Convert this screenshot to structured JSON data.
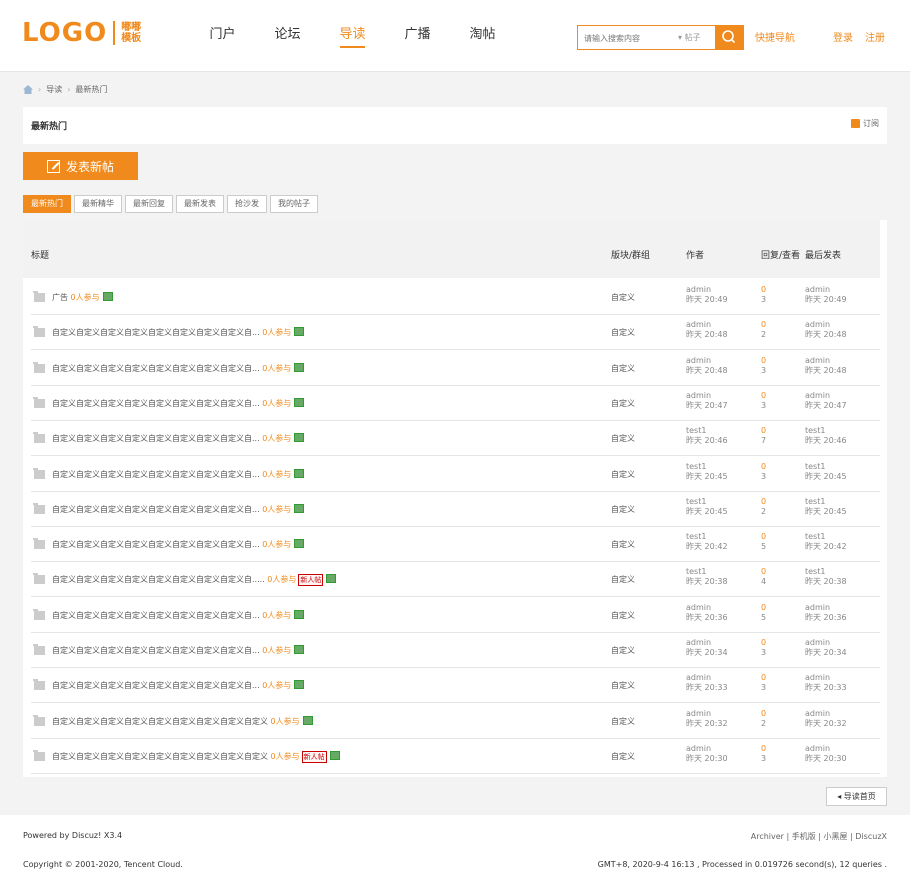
{
  "logo": {
    "text": "LOGO",
    "sub1": "嘟嘟",
    "sub2": "模板"
  },
  "nav": [
    "门户",
    "论坛",
    "导读",
    "广播",
    "淘帖"
  ],
  "search": {
    "placeholder": "请输入搜索内容",
    "scope": "▾ 帖子"
  },
  "quick_nav": "快捷导航",
  "login": "登录",
  "register": "注册",
  "breadcrumb": [
    "导读",
    "最新热门"
  ],
  "page_title": "最新热门",
  "subscribe": "订阅",
  "new_post": "发表新帖",
  "tabs": [
    "最新热门",
    "最新精华",
    "最新回复",
    "最新发表",
    "抢沙发",
    "我的帖子"
  ],
  "thead": {
    "title": "标题",
    "forum": "版块/群组",
    "author": "作者",
    "replies": "回复/查看",
    "last": "最后发表"
  },
  "rows": [
    {
      "title": "广告",
      "join": "0人参与",
      "new": "",
      "forum": "自定义",
      "author": "admin",
      "time": "昨天 20:49",
      "r": "0",
      "v": "3",
      "last_user": "admin",
      "last_time": "昨天 20:49"
    },
    {
      "title": "自定义自定义自定义自定义自定义自定义自定义自定义自...",
      "join": "0人参与",
      "new": "",
      "forum": "自定义",
      "author": "admin",
      "time": "昨天 20:48",
      "r": "0",
      "v": "2",
      "last_user": "admin",
      "last_time": "昨天 20:48"
    },
    {
      "title": "自定义自定义自定义自定义自定义自定义自定义自定义自...",
      "join": "0人参与",
      "new": "",
      "forum": "自定义",
      "author": "admin",
      "time": "昨天 20:48",
      "r": "0",
      "v": "3",
      "last_user": "admin",
      "last_time": "昨天 20:48"
    },
    {
      "title": "自定义自定义自定义自定义自定义自定义自定义自定义自...",
      "join": "0人参与",
      "new": "",
      "forum": "自定义",
      "author": "admin",
      "time": "昨天 20:47",
      "r": "0",
      "v": "3",
      "last_user": "admin",
      "last_time": "昨天 20:47"
    },
    {
      "title": "自定义自定义自定义自定义自定义自定义自定义自定义自...",
      "join": "0人参与",
      "new": "",
      "forum": "自定义",
      "author": "test1",
      "time": "昨天 20:46",
      "r": "0",
      "v": "7",
      "last_user": "test1",
      "last_time": "昨天 20:46"
    },
    {
      "title": "自定义自定义自定义自定义自定义自定义自定义自定义自...",
      "join": "0人参与",
      "new": "",
      "forum": "自定义",
      "author": "test1",
      "time": "昨天 20:45",
      "r": "0",
      "v": "3",
      "last_user": "test1",
      "last_time": "昨天 20:45"
    },
    {
      "title": "自定义自定义自定义自定义自定义自定义自定义自定义自...",
      "join": "0人参与",
      "new": "",
      "forum": "自定义",
      "author": "test1",
      "time": "昨天 20:45",
      "r": "0",
      "v": "2",
      "last_user": "test1",
      "last_time": "昨天 20:45"
    },
    {
      "title": "自定义自定义自定义自定义自定义自定义自定义自定义自...",
      "join": "0人参与",
      "new": "",
      "forum": "自定义",
      "author": "test1",
      "time": "昨天 20:42",
      "r": "0",
      "v": "5",
      "last_user": "test1",
      "last_time": "昨天 20:42"
    },
    {
      "title": "自定义自定义自定义自定义自定义自定义自定义自定义自.....",
      "join": "0人参与",
      "new": "新人帖",
      "forum": "自定义",
      "author": "test1",
      "time": "昨天 20:38",
      "r": "0",
      "v": "4",
      "last_user": "test1",
      "last_time": "昨天 20:38"
    },
    {
      "title": "自定义自定义自定义自定义自定义自定义自定义自定义自...",
      "join": "0人参与",
      "new": "",
      "forum": "自定义",
      "author": "admin",
      "time": "昨天 20:36",
      "r": "0",
      "v": "5",
      "last_user": "admin",
      "last_time": "昨天 20:36"
    },
    {
      "title": "自定义自定义自定义自定义自定义自定义自定义自定义自...",
      "join": "0人参与",
      "new": "",
      "forum": "自定义",
      "author": "admin",
      "time": "昨天 20:34",
      "r": "0",
      "v": "3",
      "last_user": "admin",
      "last_time": "昨天 20:34"
    },
    {
      "title": "自定义自定义自定义自定义自定义自定义自定义自定义自...",
      "join": "0人参与",
      "new": "",
      "forum": "自定义",
      "author": "admin",
      "time": "昨天 20:33",
      "r": "0",
      "v": "3",
      "last_user": "admin",
      "last_time": "昨天 20:33"
    },
    {
      "title": "自定义自定义自定义自定义自定义自定义自定义自定义自定义",
      "join": "0人参与",
      "new": "",
      "forum": "自定义",
      "author": "admin",
      "time": "昨天 20:32",
      "r": "0",
      "v": "2",
      "last_user": "admin",
      "last_time": "昨天 20:32"
    },
    {
      "title": "自定义自定义自定义自定义自定义自定义自定义自定义自定义",
      "join": "0人参与",
      "new": "新人帖",
      "forum": "自定义",
      "author": "admin",
      "time": "昨天 20:30",
      "r": "0",
      "v": "3",
      "last_user": "admin",
      "last_time": "昨天 20:30"
    }
  ],
  "back_button": "◂ 导读首页",
  "footer": {
    "powered": "Powered by Discuz! X3.4",
    "links": "Archiver | 手机版 | 小黑屋 | DiscuzX",
    "copyright": "Copyright © 2001-2020, Tencent Cloud.",
    "gmt": "GMT+8, 2020-9-4 16:13 , Processed in 0.019726 second(s), 12 queries ."
  },
  "colors": {
    "accent": "#f08a1d"
  }
}
